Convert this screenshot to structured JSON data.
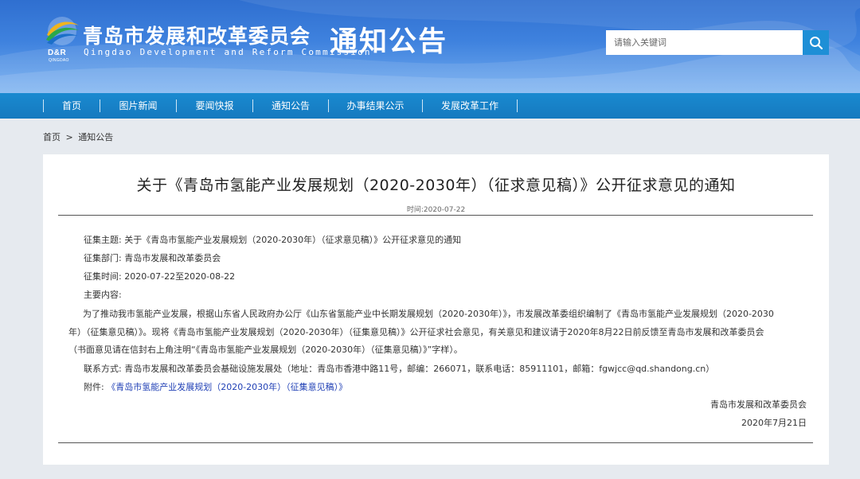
{
  "header": {
    "logo_dr": "D&R",
    "logo_qd": "QINGDAO",
    "site_name_cn": "青岛市发展和改革委员会",
    "site_name_en": "Qingdao Development and Reform Commission",
    "section_title": "通知公告",
    "search_placeholder": "请输入关键词",
    "colors": {
      "header_top": "#2f6fd0",
      "nav": "#1579bf",
      "search_button": "#1e8fd6"
    }
  },
  "nav": {
    "items": [
      {
        "label": "首页"
      },
      {
        "label": "图片新闻"
      },
      {
        "label": "要闻快报"
      },
      {
        "label": "通知公告"
      },
      {
        "label": "办事结果公示"
      },
      {
        "label": "发展改革工作"
      }
    ]
  },
  "breadcrumb": {
    "home": "首页",
    "separator": ">",
    "current": "通知公告"
  },
  "article": {
    "title": "关于《青岛市氢能产业发展规划（2020-2030年）（征求意见稿）》公开征求意见的通知",
    "time": "时间:2020-07-22",
    "subject_label": "征集主题:",
    "subject_value": "关于《青岛市氢能产业发展规划（2020-2030年）（征求意见稿）》公开征求意见的通知",
    "dept_label": "征集部门:",
    "dept_value": "青岛市发展和改革委员会",
    "period_label": "征集时间:",
    "period_value": "2020-07-22至2020-08-22",
    "content_label": "主要内容:",
    "para_line1": "为了推动我市氢能产业发展，根据山东省人民政府办公厅《山东省氢能产业中长期发展规划（2020-2030年）》，市发展改革委组织编制了《青岛市氢能产业发展规划（2020-2030",
    "para_line2": "年）（征集意见稿）》。现将《青岛市氢能产业发展规划（2020-2030年）（征集意见稿）》公开征求社会意见，有关意见和建议请于2020年8月22日前反馈至青岛市发展和改革委员会",
    "para_line3": "（书面意见请在信封右上角注明“《青岛市氢能产业发展规划（2020-2030年）（征集意见稿）》”字样）。",
    "contact_label": "联系方式:",
    "contact_value": "青岛市发展和改革委员会基础设施发展处（地址：青岛市香港中路11号，邮编：266071，联系电话：85911101，邮箱：fgwjcc@qd.shandong.cn）",
    "attachment_label": "附件:",
    "attachment_link": "《青岛市氢能产业发展规划（2020-2030年）（征集意见稿）》",
    "sign_org": "青岛市发展和改革委员会",
    "sign_date": "2020年7月21日"
  }
}
